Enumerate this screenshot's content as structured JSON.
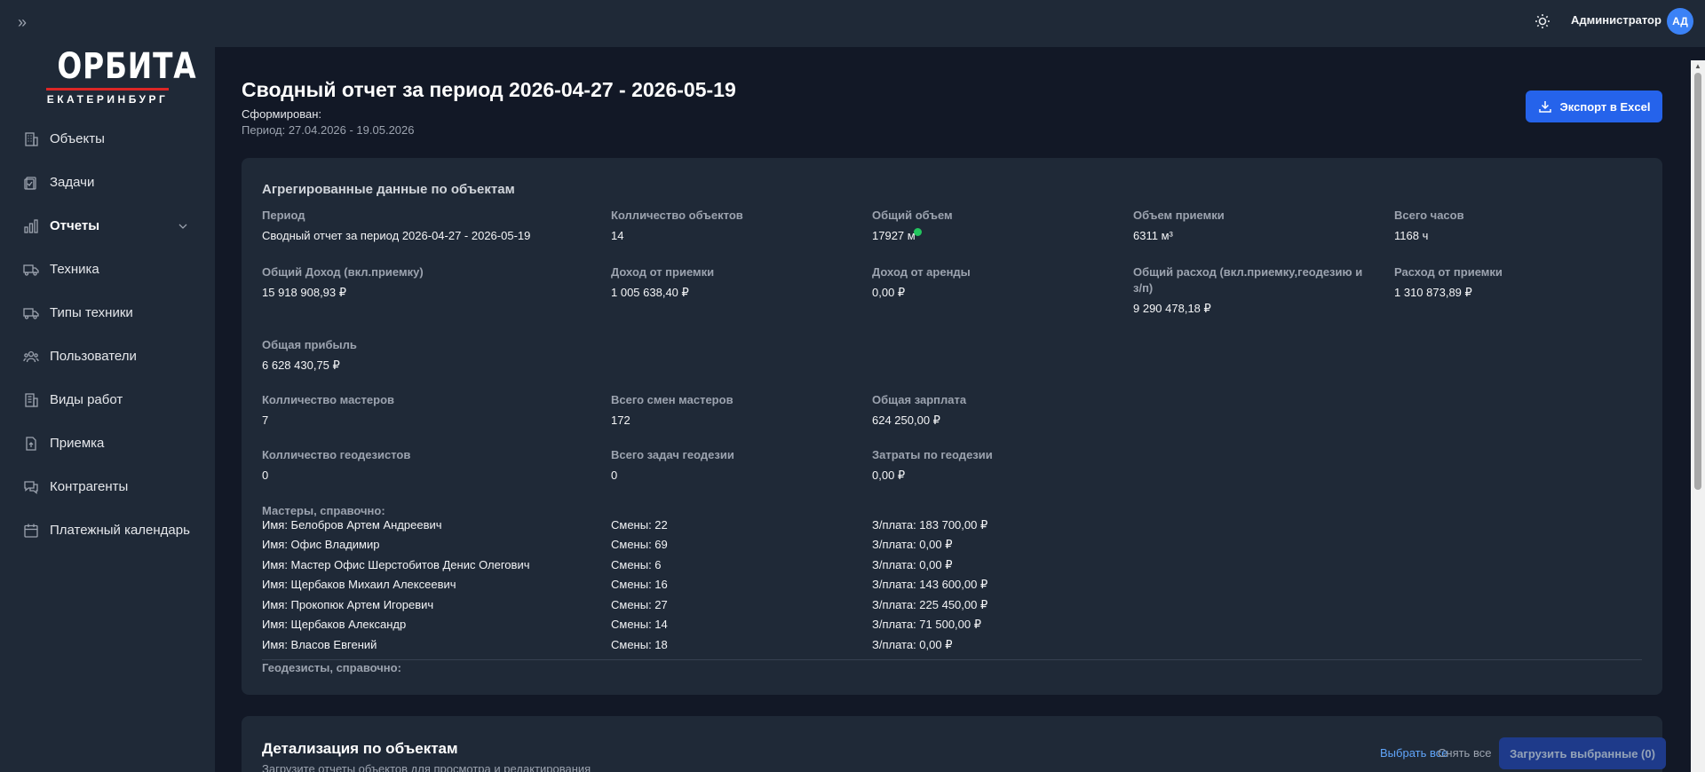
{
  "topbar": {
    "user_name": "Администратор",
    "avatar_initials": "АД"
  },
  "logo": {
    "main": "ОРБИТА",
    "sub": "ЕКАТЕРИНБУРГ",
    "accent_color": "#dc2626"
  },
  "sidebar": {
    "items": [
      {
        "label": "Объекты",
        "icon": "building-icon"
      },
      {
        "label": "Задачи",
        "icon": "tasks-icon"
      },
      {
        "label": "Отчеты",
        "icon": "bar-chart-icon",
        "active": true,
        "expandable": true
      },
      {
        "label": "Техника",
        "icon": "truck-icon"
      },
      {
        "label": "Типы техники",
        "icon": "truck-type-icon"
      },
      {
        "label": "Пользователи",
        "icon": "users-icon"
      },
      {
        "label": "Виды работ",
        "icon": "work-types-icon"
      },
      {
        "label": "Приемка",
        "icon": "acceptance-icon"
      },
      {
        "label": "Контрагенты",
        "icon": "contractors-icon"
      },
      {
        "label": "Платежный календарь",
        "icon": "calendar-icon"
      }
    ]
  },
  "header": {
    "title": "Сводный отчет за период 2026-04-27 - 2026-05-19",
    "formed_label": "Сформирован:",
    "period_text": "Период: 27.04.2026 - 19.05.2026",
    "export_label": "Экспорт в Excel"
  },
  "aggregate": {
    "title": "Агрегированные данные по объектам",
    "period_label": "Период",
    "period_value": "Сводный отчет за период 2026-04-27 - 2026-05-19",
    "objects_count_label": "Колличество объектов",
    "objects_count_value": "14",
    "total_volume_label": "Общий объем",
    "total_volume_value": "17927 м",
    "acceptance_volume_label": "Объем приемки",
    "acceptance_volume_value": "6311 м³",
    "total_hours_label": "Всего часов",
    "total_hours_value": "1168 ч",
    "total_income_label": "Общий Доход (вкл.приемку)",
    "total_income_value": "15 918 908,93 ₽",
    "acceptance_income_label": "Доход от приемки",
    "acceptance_income_value": "1 005 638,40 ₽",
    "rent_income_label": "Доход от аренды",
    "rent_income_value": "0,00 ₽",
    "total_expense_label": "Общий расход (вкл.приемку,геодезию и з/п)",
    "total_expense_value": "9 290 478,18 ₽",
    "acceptance_expense_label": "Расход от приемки",
    "acceptance_expense_value": "1 310 873,89 ₽",
    "total_profit_label": "Общая прибыль",
    "total_profit_value": "6 628 430,75 ₽",
    "masters_count_label": "Колличество мастеров",
    "masters_count_value": "7",
    "masters_shifts_label": "Всего смен мастеров",
    "masters_shifts_value": "172",
    "total_salary_label": "Общая зарплата",
    "total_salary_value": "624 250,00 ₽",
    "geodesists_count_label": "Колличество геодезистов",
    "geodesists_count_value": "0",
    "geodesy_tasks_label": "Всего задач геодезии",
    "geodesy_tasks_value": "0",
    "geodesy_costs_label": "Затраты по геодезии",
    "geodesy_costs_value": "0,00 ₽",
    "masters_ref_label": "Мастеры, справочно:",
    "masters": [
      {
        "name": "Имя: Белобров Артем Андреевич",
        "shifts": "Смены: 22",
        "salary": "З/плата: 183 700,00 ₽"
      },
      {
        "name": "Имя: Офис Владимир",
        "shifts": "Смены: 69",
        "salary": "З/плата: 0,00 ₽"
      },
      {
        "name": "Имя: Мастер Офис Шерстобитов Денис Олегович",
        "shifts": "Смены: 6",
        "salary": "З/плата: 0,00 ₽"
      },
      {
        "name": "Имя: Щербаков Михаил Алексеевич",
        "shifts": "Смены: 16",
        "salary": "З/плата: 143 600,00 ₽"
      },
      {
        "name": "Имя: Прокопюк Артем Игоревич",
        "shifts": "Смены: 27",
        "salary": "З/плата: 225 450,00 ₽"
      },
      {
        "name": "Имя: Щербаков Александр",
        "shifts": "Смены: 14",
        "salary": "З/плата: 71 500,00 ₽"
      },
      {
        "name": "Имя: Власов Евгений",
        "shifts": "Смены: 18",
        "salary": "З/плата: 0,00 ₽"
      }
    ],
    "geodesists_ref_label": "Геодезисты, справочно:"
  },
  "details": {
    "title": "Детализация по объектам",
    "subtitle": "Загрузите отчеты объектов для просмотра и редактирования",
    "select_all": "Выбрать все",
    "deselect_all": "Снять все",
    "load_selected": "Загрузить выбранные (0)"
  }
}
